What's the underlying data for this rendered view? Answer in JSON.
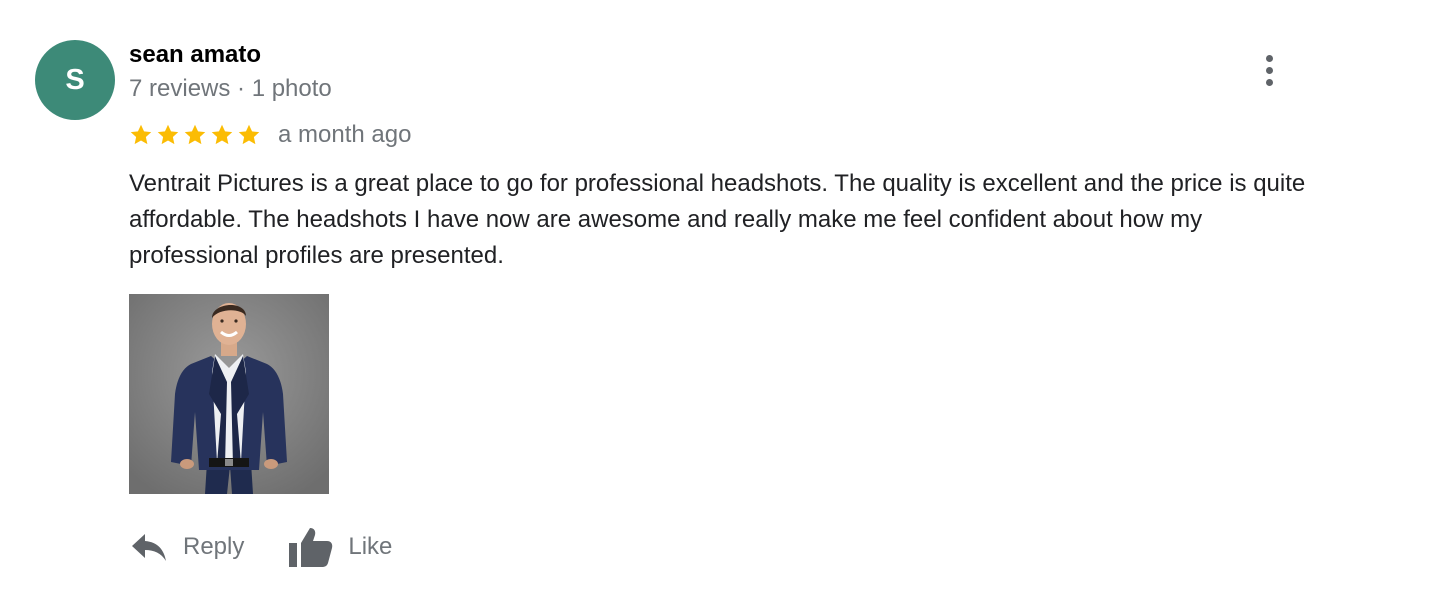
{
  "review": {
    "author": {
      "initial": "S",
      "name": "sean amato",
      "meta": "7 reviews · 1 photo",
      "avatar_color": "#3d8a78"
    },
    "rating": {
      "stars": 5,
      "max_stars": 5,
      "star_color": "#fbbc04"
    },
    "date": "a month ago",
    "text": "Ventrait Pictures is a great place to go for professional headshots. The quality is excellent and the price is quite affordable. The headshots I have now are awesome and really make me feel confident about how my professional profiles are presented.",
    "more_icon": "more-vert-icon",
    "actions": {
      "reply_label": "Reply",
      "reply_icon": "reply-icon",
      "like_label": "Like",
      "like_icon": "thumbs-up-icon"
    }
  }
}
